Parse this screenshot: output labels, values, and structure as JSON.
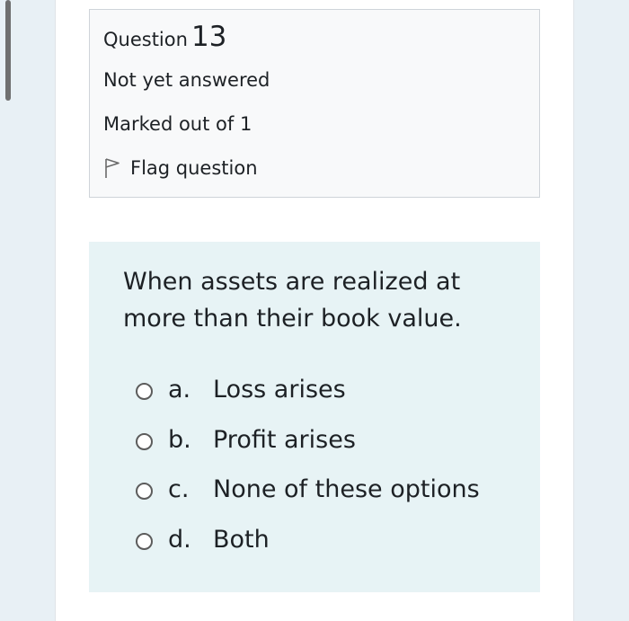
{
  "question": {
    "label": "Question",
    "number": "13",
    "state": "Not yet answered",
    "grade": "Marked out of 1",
    "flag_label": "Flag question",
    "flag_icon": "flag-icon"
  },
  "question_text": "When assets are realized at more than their book value.",
  "options": [
    {
      "letter": "a.",
      "text": "Loss arises"
    },
    {
      "letter": "b.",
      "text": "Profit arises"
    },
    {
      "letter": "c.",
      "text": "None of these options"
    },
    {
      "letter": "d.",
      "text": "Both"
    }
  ],
  "colors": {
    "info_background": "#f8f9fa",
    "formulation_background": "#e7f3f5",
    "side_background": "#e8f0f5",
    "text": "#1d2125"
  }
}
